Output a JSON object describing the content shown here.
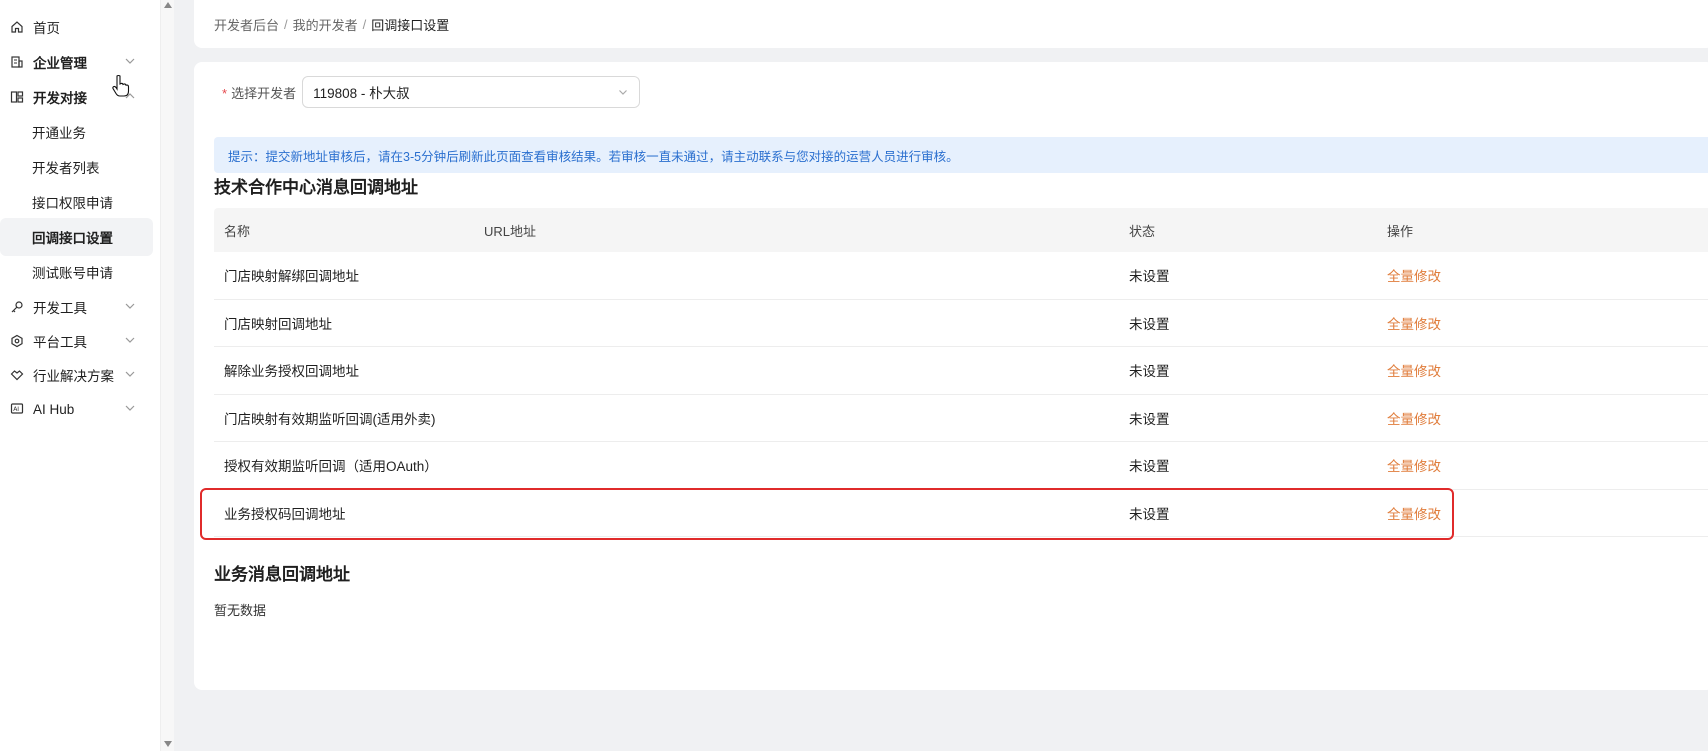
{
  "sidebar": {
    "items": [
      {
        "label": "首页",
        "icon": "home-icon"
      },
      {
        "label": "企业管理",
        "icon": "building-icon"
      },
      {
        "label": "开发对接",
        "icon": "dev-connect-icon"
      },
      {
        "label": "开发工具",
        "icon": "key-icon"
      },
      {
        "label": "平台工具",
        "icon": "hexagon-settings-icon"
      },
      {
        "label": "行业解决方案",
        "icon": "handshake-icon"
      },
      {
        "label": "AI Hub",
        "icon": "ai-icon"
      }
    ],
    "subitems": [
      {
        "label": "开通业务"
      },
      {
        "label": "开发者列表"
      },
      {
        "label": "接口权限申请"
      },
      {
        "label": "回调接口设置"
      },
      {
        "label": "测试账号申请"
      }
    ]
  },
  "breadcrumb": {
    "items": [
      "开发者后台",
      "我的开发者",
      "回调接口设置"
    ],
    "separator": "/"
  },
  "developer_select": {
    "required_mark": "*",
    "label": "选择开发者",
    "value": "119808 - 朴大叔"
  },
  "alert": {
    "text": "提示：提交新地址审核后，请在3-5分钟后刷新此页面查看审核结果。若审核一直未通过，请主动联系与您对接的运营人员进行审核。"
  },
  "section1": {
    "title": "技术合作中心消息回调地址",
    "columns": [
      "名称",
      "URL地址",
      "状态",
      "操作"
    ],
    "rows": [
      {
        "name": "门店映射解绑回调地址",
        "url": "",
        "status": "未设置",
        "action": "全量修改"
      },
      {
        "name": "门店映射回调地址",
        "url": "",
        "status": "未设置",
        "action": "全量修改"
      },
      {
        "name": "解除业务授权回调地址",
        "url": "",
        "status": "未设置",
        "action": "全量修改"
      },
      {
        "name": "门店映射有效期监听回调(适用外卖)",
        "url": "",
        "status": "未设置",
        "action": "全量修改"
      },
      {
        "name": "授权有效期监听回调（适用OAuth）",
        "url": "",
        "status": "未设置",
        "action": "全量修改"
      },
      {
        "name": "业务授权码回调地址",
        "url": "",
        "status": "未设置",
        "action": "全量修改"
      }
    ]
  },
  "section2": {
    "title": "业务消息回调地址",
    "empty_text": "暂无数据"
  },
  "colors": {
    "action_link": "#e07d3c",
    "alert_bg": "#e6f0fd",
    "alert_text": "#2a6fcf",
    "highlight_border": "#e02b2b",
    "required": "#e5484d"
  }
}
